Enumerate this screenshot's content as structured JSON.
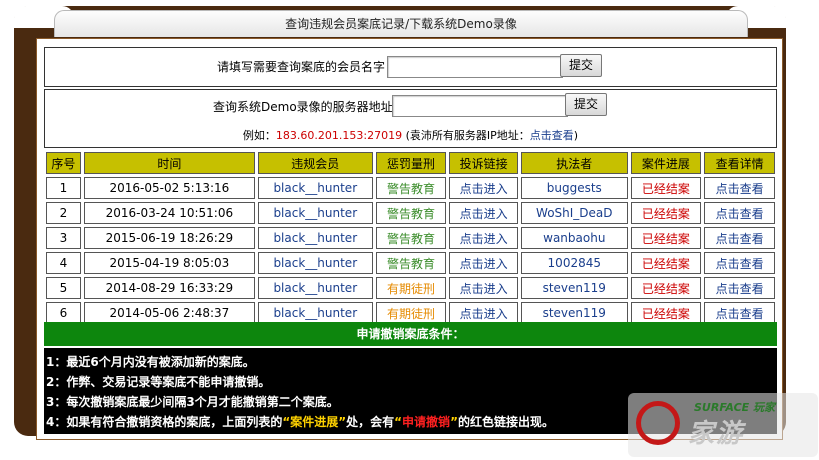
{
  "window": {
    "title": "查询违规会员案底记录/下载系统Demo录像"
  },
  "member_query": {
    "label": "请填写需要查询案底的会员名字",
    "value": "",
    "submit_label": "提交"
  },
  "demo_query": {
    "label": "查询系统Demo录像的服务器地址",
    "value": "",
    "submit_label": "提交",
    "example_prefix": "例如：",
    "example_ip": "183.60.201.153:27019",
    "example_middle": " (袁沛所有服务器IP地址：",
    "example_link": "点击查看",
    "example_suffix": ")"
  },
  "table": {
    "headers": [
      "序号",
      "时间",
      "违规会员",
      "惩罚量刑",
      "投诉链接",
      "执法者",
      "案件进展",
      "查看详情"
    ],
    "rows": [
      {
        "no": "1",
        "time": "2016-05-02 5:13:16",
        "member": "black__hunter",
        "penalty": "警告教育",
        "penalty_color": "green",
        "complaint": "点击进入",
        "enforcer": "buggests",
        "progress": "已经结案",
        "detail": "点击查看"
      },
      {
        "no": "2",
        "time": "2016-03-24 10:51:06",
        "member": "black__hunter",
        "penalty": "警告教育",
        "penalty_color": "green",
        "complaint": "点击进入",
        "enforcer": "WoShI_DeaD",
        "progress": "已经结案",
        "detail": "点击查看"
      },
      {
        "no": "3",
        "time": "2015-06-19 18:26:29",
        "member": "black__hunter",
        "penalty": "警告教育",
        "penalty_color": "green",
        "complaint": "点击进入",
        "enforcer": "wanbaohu",
        "progress": "已经结案",
        "detail": "点击查看"
      },
      {
        "no": "4",
        "time": "2015-04-19 8:05:03",
        "member": "black__hunter",
        "penalty": "警告教育",
        "penalty_color": "green",
        "complaint": "点击进入",
        "enforcer": "1002845",
        "progress": "已经结案",
        "detail": "点击查看"
      },
      {
        "no": "5",
        "time": "2014-08-29 16:33:29",
        "member": "black__hunter",
        "penalty": "有期徒刑",
        "penalty_color": "orange",
        "complaint": "点击进入",
        "enforcer": "steven119",
        "progress": "已经结案",
        "detail": "点击查看"
      },
      {
        "no": "6",
        "time": "2014-05-06 2:48:37",
        "member": "black__hunter",
        "penalty": "有期徒刑",
        "penalty_color": "orange",
        "complaint": "点击进入",
        "enforcer": "steven119",
        "progress": "已经结案",
        "detail": "点击查看"
      }
    ]
  },
  "conditions": {
    "title": "申请撤销案底条件：",
    "items": [
      "1：最近6个月内没有被添加新的案底。",
      "2：作弊、交易记录等案底不能申请撤销。",
      "3：每次撤销案底最少间隔3个月才能撤销第二个案底。"
    ],
    "item4_prefix": "4：如果有符合撤销资格的案底，上面列表的",
    "item4_quote1": "“案件进展”",
    "item4_middle": "处，会有",
    "item4_quote_open": "“",
    "item4_red": "申请撤销",
    "item4_quote_close": "”",
    "item4_suffix": "的红色链接出现。"
  },
  "watermark": {
    "text_top": "SURFACE 玩家",
    "text_main": "家游"
  },
  "colors": {
    "header_bg": "#c6c000",
    "green_bar": "#0d860d",
    "link_blue": "#1a3e8c",
    "penalty_green": "#3a8c2a",
    "penalty_orange": "#e58a00",
    "closed_red": "#cc0000"
  }
}
